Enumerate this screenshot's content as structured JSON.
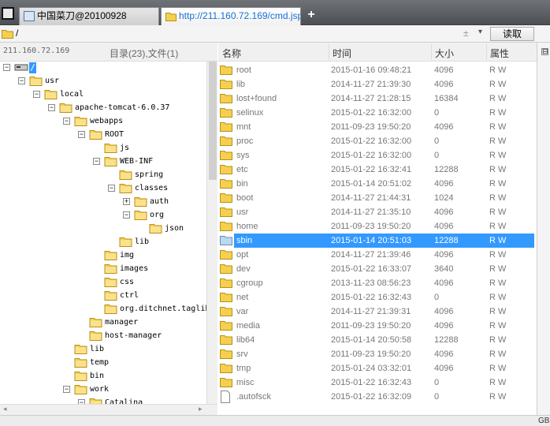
{
  "browser": {
    "tabs": [
      {
        "label": "中国菜刀@20100928",
        "close": "×"
      },
      {
        "label": "http://211.160.72.169/cmd.jsp",
        "close": "×"
      }
    ],
    "new_tab": "+"
  },
  "address": {
    "path": "/",
    "plus_minus": "±",
    "dropdown": "▾",
    "read_button": "读取"
  },
  "left_header": {
    "host": "211.160.72.169",
    "summary": "目录(23),文件(1)"
  },
  "tree": [
    {
      "label": "/",
      "type": "root",
      "expander": "⊟"
    },
    {
      "label": "usr",
      "expander": "⊟"
    },
    {
      "label": "local",
      "expander": "⊟"
    },
    {
      "label": "apache-tomcat-6.0.37",
      "expander": "⊟"
    },
    {
      "label": "webapps",
      "expander": "⊟"
    },
    {
      "label": "ROOT",
      "expander": "⊟"
    },
    {
      "label": "js",
      "expander": ""
    },
    {
      "label": "WEB-INF",
      "expander": "⊟"
    },
    {
      "label": "spring",
      "expander": ""
    },
    {
      "label": "classes",
      "expander": "⊟"
    },
    {
      "label": "auth",
      "expander": "⊞"
    },
    {
      "label": "org",
      "expander": "⊟"
    },
    {
      "label": "json",
      "expander": ""
    },
    {
      "label": "lib",
      "expander": ""
    },
    {
      "label": "img",
      "expander": ""
    },
    {
      "label": "images",
      "expander": ""
    },
    {
      "label": "css",
      "expander": ""
    },
    {
      "label": "ctrl",
      "expander": ""
    },
    {
      "label": "org.ditchnet.taglib",
      "expander": ""
    },
    {
      "label": "manager",
      "expander": ""
    },
    {
      "label": "host-manager",
      "expander": ""
    },
    {
      "label": "lib",
      "expander": ""
    },
    {
      "label": "temp",
      "expander": ""
    },
    {
      "label": "bin",
      "expander": ""
    },
    {
      "label": "work",
      "expander": "⊟"
    },
    {
      "label": "Catalina",
      "expander": "⊟"
    }
  ],
  "columns": {
    "name": "名称",
    "time": "时间",
    "size": "大小",
    "attr": "属性"
  },
  "files": [
    {
      "name": "root",
      "time": "2015-01-16 09:48:21",
      "size": "4096",
      "attr": "R W",
      "kind": "folder"
    },
    {
      "name": "lib",
      "time": "2014-11-27 21:39:30",
      "size": "4096",
      "attr": "R W",
      "kind": "folder"
    },
    {
      "name": "lost+found",
      "time": "2014-11-27 21:28:15",
      "size": "16384",
      "attr": "R W",
      "kind": "folder"
    },
    {
      "name": "selinux",
      "time": "2015-01-22 16:32:00",
      "size": "0",
      "attr": "R W",
      "kind": "folder"
    },
    {
      "name": "mnt",
      "time": "2011-09-23 19:50:20",
      "size": "4096",
      "attr": "R W",
      "kind": "folder"
    },
    {
      "name": "proc",
      "time": "2015-01-22 16:32:00",
      "size": "0",
      "attr": "R W",
      "kind": "folder"
    },
    {
      "name": "sys",
      "time": "2015-01-22 16:32:00",
      "size": "0",
      "attr": "R W",
      "kind": "folder"
    },
    {
      "name": "etc",
      "time": "2015-01-22 16:32:41",
      "size": "12288",
      "attr": "R W",
      "kind": "folder"
    },
    {
      "name": "bin",
      "time": "2015-01-14 20:51:02",
      "size": "4096",
      "attr": "R W",
      "kind": "folder"
    },
    {
      "name": "boot",
      "time": "2014-11-27 21:44:31",
      "size": "1024",
      "attr": "R W",
      "kind": "folder"
    },
    {
      "name": "usr",
      "time": "2014-11-27 21:35:10",
      "size": "4096",
      "attr": "R W",
      "kind": "folder"
    },
    {
      "name": "home",
      "time": "2011-09-23 19:50:20",
      "size": "4096",
      "attr": "R W",
      "kind": "folder"
    },
    {
      "name": "sbin",
      "time": "2015-01-14 20:51:03",
      "size": "12288",
      "attr": "R W",
      "kind": "folder",
      "selected": true
    },
    {
      "name": "opt",
      "time": "2014-11-27 21:39:46",
      "size": "4096",
      "attr": "R W",
      "kind": "folder"
    },
    {
      "name": "dev",
      "time": "2015-01-22 16:33:07",
      "size": "3640",
      "attr": "R W",
      "kind": "folder"
    },
    {
      "name": "cgroup",
      "time": "2013-11-23 08:56:23",
      "size": "4096",
      "attr": "R W",
      "kind": "folder"
    },
    {
      "name": "net",
      "time": "2015-01-22 16:32:43",
      "size": "0",
      "attr": "R W",
      "kind": "folder"
    },
    {
      "name": "var",
      "time": "2014-11-27 21:39:31",
      "size": "4096",
      "attr": "R W",
      "kind": "folder"
    },
    {
      "name": "media",
      "time": "2011-09-23 19:50:20",
      "size": "4096",
      "attr": "R W",
      "kind": "folder"
    },
    {
      "name": "lib64",
      "time": "2015-01-14 20:50:58",
      "size": "12288",
      "attr": "R W",
      "kind": "folder"
    },
    {
      "name": "srv",
      "time": "2011-09-23 19:50:20",
      "size": "4096",
      "attr": "R W",
      "kind": "folder"
    },
    {
      "name": "tmp",
      "time": "2015-01-24 03:32:01",
      "size": "4096",
      "attr": "R W",
      "kind": "folder"
    },
    {
      "name": "misc",
      "time": "2015-01-22 16:32:43",
      "size": "0",
      "attr": "R W",
      "kind": "folder"
    },
    {
      "name": ".autofsck",
      "time": "2015-01-22 16:32:09",
      "size": "0",
      "attr": "R W",
      "kind": "file"
    }
  ],
  "right_panel": {
    "expander": "⊟"
  },
  "status": {
    "encoding": "GB"
  },
  "colors": {
    "selection": "#3399ff",
    "folder": "#f5d04e"
  }
}
